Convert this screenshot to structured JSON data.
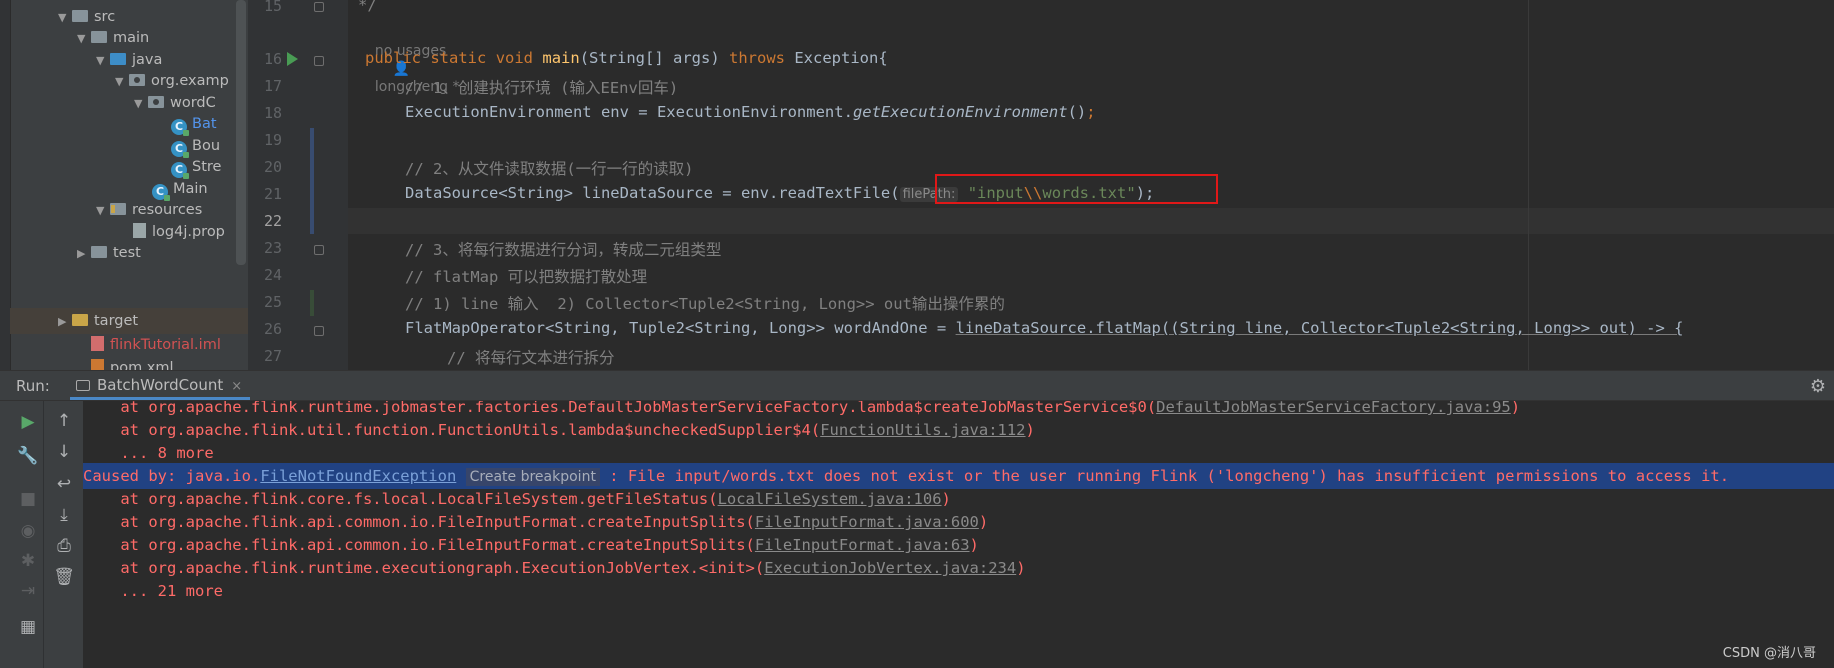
{
  "project_tree": {
    "items": [
      {
        "label": "src",
        "icon": "folder-icon"
      },
      {
        "label": "main",
        "icon": "folder-icon"
      },
      {
        "label": "java",
        "icon": "source-folder-icon"
      },
      {
        "label": "org.examp",
        "icon": "package-icon"
      },
      {
        "label": "wordC",
        "icon": "package-icon"
      },
      {
        "label": "Bat",
        "icon": "java-class-icon"
      },
      {
        "label": "Bou",
        "icon": "java-class-icon"
      },
      {
        "label": "Stre",
        "icon": "java-class-icon"
      },
      {
        "label": "Main",
        "icon": "java-class-icon"
      },
      {
        "label": "resources",
        "icon": "resources-folder-icon"
      },
      {
        "label": "log4j.prop",
        "icon": "properties-file-icon"
      },
      {
        "label": "test",
        "icon": "folder-icon"
      },
      {
        "label": "target",
        "icon": "excluded-folder-icon"
      },
      {
        "label": "flinkTutorial.iml",
        "icon": "iml-file-icon"
      },
      {
        "label": "pom.xml",
        "icon": "maven-file-icon"
      }
    ]
  },
  "editor": {
    "line_numbers": [
      "15",
      "16",
      "17",
      "18",
      "19",
      "20",
      "21",
      "22",
      "23",
      "24",
      "25",
      "26",
      "27"
    ],
    "current_line": "22",
    "usage_hint": "no usages",
    "author_hint": "longcheng *",
    "lines": {
      "l15": "*/",
      "l16_kw1": "public",
      "l16_kw2": "static",
      "l16_kw3": "void",
      "l16_name": "main",
      "l16_params": "(String[] args) ",
      "l16_throws": "throws",
      "l16_rest": " Exception{",
      "l17": "// 1、创建执行环境 (输入EEnv回车)",
      "l18_a": "ExecutionEnvironment env = ExecutionEnvironment.",
      "l18_b": "getExecutionEnvironment",
      "l18_c": "()",
      "l18_semi": ";",
      "l20": "// 2、从文件读取数据(一行一行的读取)",
      "l21_a": "DataSource<String> lineDataSource = env.readTextFile(",
      "l21_hint": "filePath:",
      "l21_str1": "\"input",
      "l21_esc": "\\\\",
      "l21_str2": "words.txt\"",
      "l21_end": ");",
      "l23": "// 3、将每行数据进行分词，转成二元组类型",
      "l24": "// flatMap 可以把数据打散处理",
      "l25": "// 1) line 输入  2) Collector<Tuple2<String, Long>> out输出操作累的",
      "l26_a": "FlatMapOperator<String, Tuple2<String, Long>> wordAndOne = ",
      "l26_b": "lineDataSource.flatMap((String line, Collector<Tuple2<String, Long>> out) -> {",
      "l27": "// 将每行文本进行拆分"
    }
  },
  "run_panel": {
    "label": "Run:",
    "tab": "BatchWordCount",
    "close_glyph": "×",
    "console": {
      "l1_a": "    at org.apache.flink.runtime.jobmaster.factories.DefaultJobMasterServiceFactory.lambda$createJobMasterService$0(",
      "l1_link": "DefaultJobMasterServiceFactory.java:95",
      "l1_end": ")",
      "l2_a": "    at org.apache.flink.util.function.FunctionUtils.lambda$uncheckedSupplier$4(",
      "l2_link": "FunctionUtils.java:112",
      "l2_end": ")",
      "l3": "    ... 8 more",
      "l4_a": "Caused by: java.io.",
      "l4_link": "FileNotFoundException",
      "l4_hint": "Create breakpoint",
      "l4_b": " : File input/words.txt does not exist or the user running Flink ('longcheng') has insufficient permissions to access it.",
      "l5_a": "    at org.apache.flink.core.fs.local.LocalFileSystem.getFileStatus(",
      "l5_link": "LocalFileSystem.java:106",
      "l5_end": ")",
      "l6_a": "    at org.apache.flink.api.common.io.FileInputFormat.createInputSplits(",
      "l6_link": "FileInputFormat.java:600",
      "l6_end": ")",
      "l7_a": "    at org.apache.flink.api.common.io.FileInputFormat.createInputSplits(",
      "l7_link": "FileInputFormat.java:63",
      "l7_end": ")",
      "l8_a": "    at org.apache.flink.runtime.executiongraph.ExecutionJobVertex.<init>(",
      "l8_link": "ExecutionJobVertex.java:234",
      "l8_end": ")",
      "l9": "    ... 21 more"
    }
  },
  "watermark": "CSDN @消八哥",
  "colors": {
    "error_text": "#ff6b68",
    "selected_line": "#214283",
    "highlight_box": "#e01818",
    "keyword": "#cc7832",
    "string": "#6a8759",
    "comment": "#808080"
  }
}
